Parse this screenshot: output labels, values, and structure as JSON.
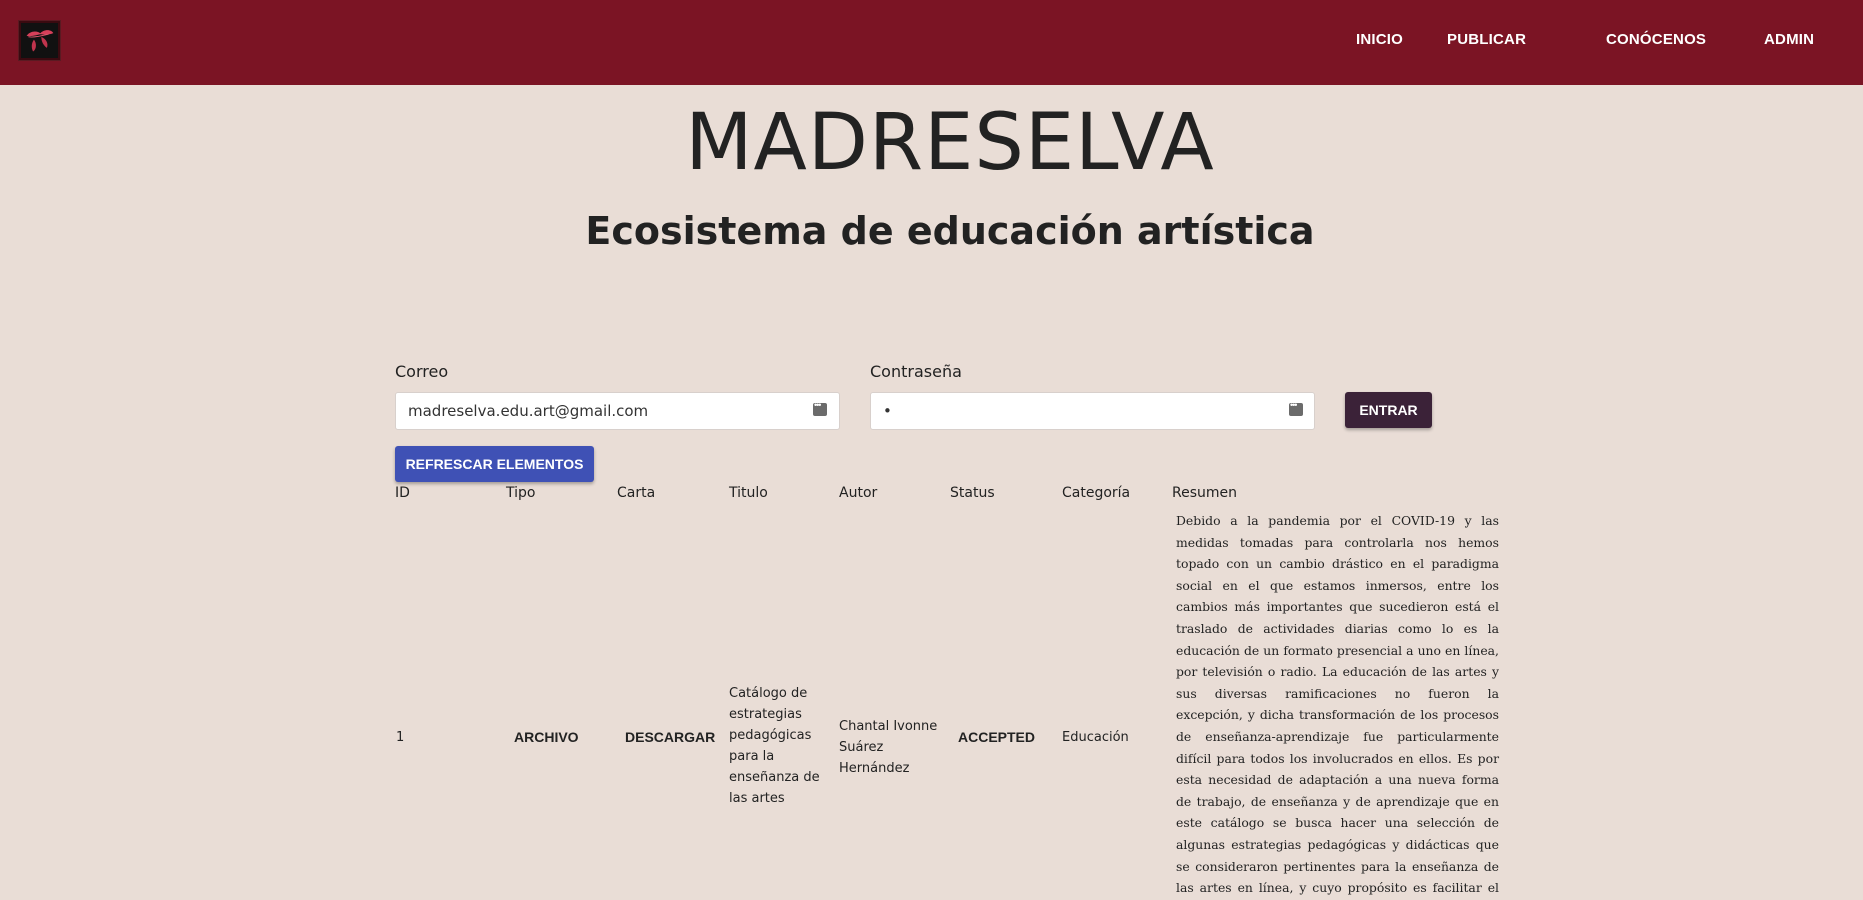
{
  "nav": {
    "logo_icon": "madreselva-leaf-logo",
    "links": [
      "INICIO",
      "PUBLICAR",
      "CONÓCENOS",
      "ADMIN"
    ]
  },
  "hero": {
    "title": "MADRESELVA",
    "subtitle": "Ecosistema de educación artística"
  },
  "login": {
    "email_label": "Correo",
    "email_value": "madreselva.edu.art@gmail.com",
    "password_label": "Contraseña",
    "password_value": "•",
    "submit_label": "ENTRAR"
  },
  "refresh_label": "REFRESCAR ELEMENTOS",
  "table": {
    "headers": [
      "ID",
      "Tipo",
      "Carta",
      "Titulo",
      "Autor",
      "Status",
      "Categoría",
      "Resumen"
    ],
    "rows": [
      {
        "id": "1",
        "tipo": "ARCHIVO",
        "carta": "DESCARGAR",
        "titulo": "Catálogo de estrategias pedagógicas para la enseñanza de las artes",
        "autor": "Chantal Ivonne Suárez Hernández",
        "status": "ACCEPTED",
        "categoria": "Educación",
        "resumen": "Debido a la pandemia por el COVID-19 y las medidas tomadas para controlarla nos hemos topado con un cambio drástico en el paradigma social en el que estamos inmersos, entre los cambios más importantes que sucedieron está el traslado de actividades diarias como lo es la educación de un formato presencial a uno en línea, por televisión o radio. La educación de las artes y sus diversas ramificaciones no fueron la excepción, y dicha transformación de los procesos de enseñanza-aprendizaje fue particularmente difícil para todos los involucrados en ellos. Es por esta necesidad de adaptación a una nueva forma de trabajo, de enseñanza y de aprendizaje que en este catálogo se busca hacer una selección de algunas estrategias pedagógicas y didácticas que se consideraron pertinentes para la enseñanza de las artes en línea, y cuyo propósito es facilitar el trabajo de búsqueda del educador, permitiéndole así centrarse únicamente en"
      }
    ]
  },
  "colors": {
    "navbar": "#7b1424",
    "background": "#e9ddd6",
    "enter_button": "#3b2238",
    "refresh_button": "#3f51b5"
  }
}
